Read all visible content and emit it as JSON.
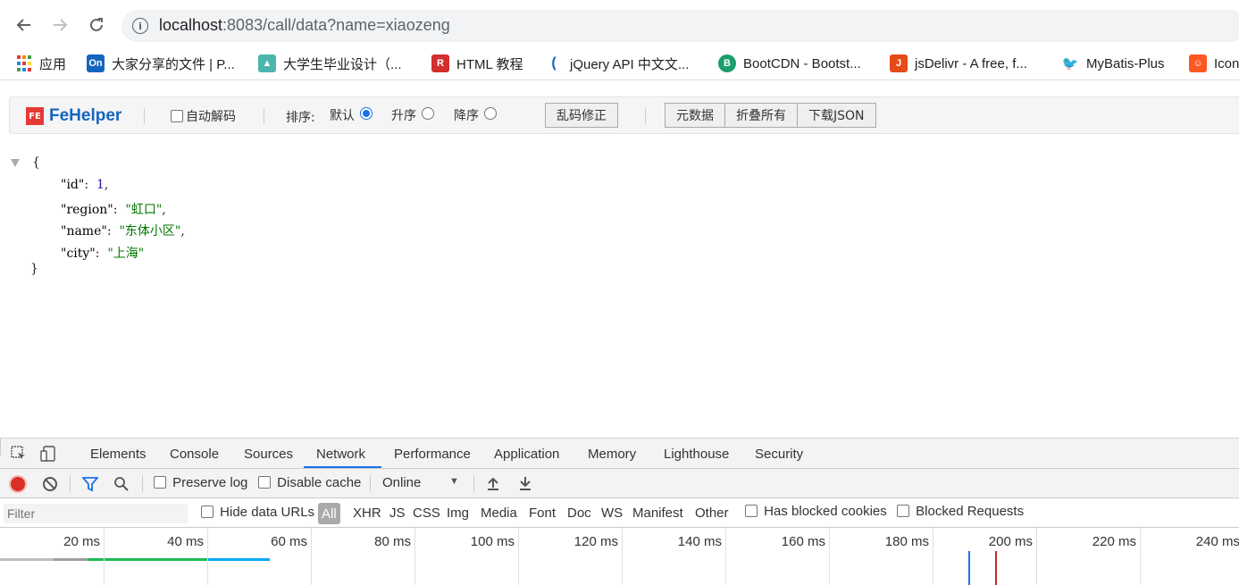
{
  "browser": {
    "url_host": "localhost",
    "url_rest": ":8083/call/data?name=xiaozeng",
    "bookmarks": [
      {
        "label": "应用",
        "icon": "apps-grid-icon",
        "color": "#e53935"
      },
      {
        "label": "大家分享的文件 | P...",
        "icon": "on-logo-icon",
        "color": "#1565c0"
      },
      {
        "label": "大学生毕业设计（...",
        "icon": "graduation-icon",
        "color": "#4db6ac"
      },
      {
        "label": "HTML 教程",
        "icon": "runoob-icon",
        "color": "#d32f2f"
      },
      {
        "label": "jQuery API 中文文...",
        "icon": "jquery-icon",
        "color": "#1565c0"
      },
      {
        "label": "BootCDN - Bootst...",
        "icon": "bootcdn-icon",
        "color": "#1b9e6a"
      },
      {
        "label": "jsDelivr - A free, f...",
        "icon": "jsdelivr-icon",
        "color": "#e64a19"
      },
      {
        "label": "MyBatis-Plus",
        "icon": "bird-icon",
        "color": "#222222"
      },
      {
        "label": "Icon",
        "icon": "iconfont-icon",
        "color": "#ff5722"
      }
    ]
  },
  "fehelper": {
    "logo_mark": "FE",
    "logo_name": "FeHelper",
    "auto_decode_label": "自动解码",
    "sort_label": "排序:",
    "sort_options": [
      "默认",
      "升序",
      "降序"
    ],
    "sort_selected": "默认",
    "fix_garbled_button": "乱码修正",
    "buttons": [
      "元数据",
      "折叠所有",
      "下载JSON"
    ]
  },
  "json_view": {
    "open_brace": "{",
    "close_brace": "}",
    "entries": [
      {
        "key": "\"id\"",
        "value": "1",
        "type": "number"
      },
      {
        "key": "\"region\"",
        "value": "\"虹口\"",
        "type": "string"
      },
      {
        "key": "\"name\"",
        "value": "\"东体小区\"",
        "type": "string"
      },
      {
        "key": "\"city\"",
        "value": "\"上海\"",
        "type": "string"
      }
    ]
  },
  "devtools": {
    "tabs": [
      "Elements",
      "Console",
      "Sources",
      "Network",
      "Performance",
      "Application",
      "Memory",
      "Lighthouse",
      "Security"
    ],
    "active_tab": "Network",
    "toolbar": {
      "preserve_log": "Preserve log",
      "disable_cache": "Disable cache",
      "throttling": "Online"
    },
    "filter": {
      "placeholder": "Filter",
      "hide_data_urls": "Hide data URLs",
      "types": [
        "All",
        "XHR",
        "JS",
        "CSS",
        "Img",
        "Media",
        "Font",
        "Doc",
        "WS",
        "Manifest",
        "Other"
      ],
      "has_blocked_cookies": "Has blocked cookies",
      "blocked_requests": "Blocked Requests"
    },
    "timeline_ticks": [
      "20 ms",
      "40 ms",
      "60 ms",
      "80 ms",
      "100 ms",
      "120 ms",
      "140 ms",
      "160 ms",
      "180 ms",
      "200 ms",
      "220 ms",
      "240 ms"
    ],
    "colors": {
      "active_tab": "#1a73e8",
      "dom_content_loaded": "#1a73e8",
      "load": "#c62828"
    }
  }
}
